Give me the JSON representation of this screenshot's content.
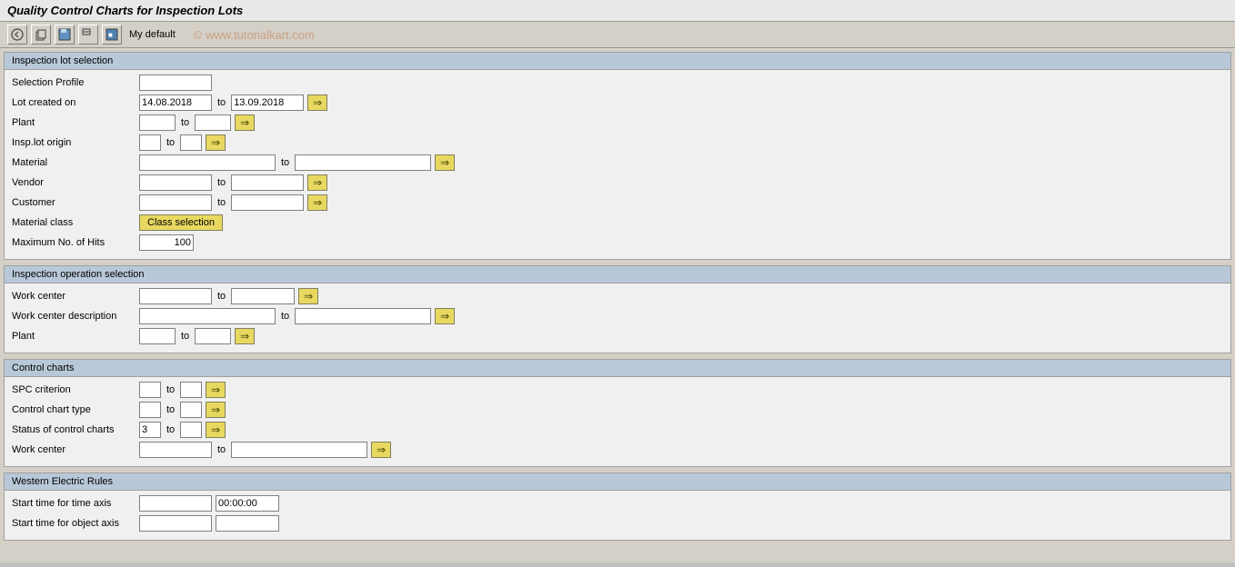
{
  "title": "Quality Control Charts for Inspection Lots",
  "toolbar": {
    "buttons": [
      "back",
      "forward",
      "save",
      "find",
      "settings"
    ],
    "default_label": "My default"
  },
  "watermark": "© www.tutorialkart.com",
  "sections": {
    "inspection_lot": {
      "header": "Inspection lot selection",
      "fields": {
        "selection_profile": {
          "label": "Selection Profile",
          "value": "",
          "type": "single"
        },
        "lot_created_on": {
          "label": "Lot created on",
          "from": "14.08.2018",
          "to": "13.09.2018",
          "has_arrow": true
        },
        "plant": {
          "label": "Plant",
          "from": "",
          "to": "",
          "has_arrow": true,
          "size": "small"
        },
        "insp_lot_origin": {
          "label": "Insp.lot origin",
          "from": "",
          "to": "",
          "has_arrow": true,
          "size": "tiny"
        },
        "material": {
          "label": "Material",
          "from": "",
          "to": "",
          "has_arrow": true,
          "size": "large"
        },
        "vendor": {
          "label": "Vendor",
          "from": "",
          "to": "",
          "has_arrow": true,
          "size": "medium"
        },
        "customer": {
          "label": "Customer",
          "from": "",
          "to": "",
          "has_arrow": true,
          "size": "medium"
        },
        "material_class": {
          "label": "Material class",
          "button": "Class selection"
        },
        "max_hits": {
          "label": "Maximum No. of Hits",
          "value": "100"
        }
      }
    },
    "inspection_operation": {
      "header": "Inspection operation selection",
      "fields": {
        "work_center": {
          "label": "Work center",
          "from": "",
          "to": "",
          "has_arrow": true
        },
        "work_center_desc": {
          "label": "Work center description",
          "from": "",
          "to": "",
          "has_arrow": true
        },
        "plant": {
          "label": "Plant",
          "from": "",
          "to": "",
          "has_arrow": true,
          "size": "small"
        }
      }
    },
    "control_charts": {
      "header": "Control charts",
      "fields": {
        "spc_criterion": {
          "label": "SPC criterion",
          "from": "",
          "to": "",
          "has_arrow": true,
          "size": "tiny"
        },
        "control_chart_type": {
          "label": "Control chart type",
          "from": "",
          "to": "",
          "has_arrow": true,
          "size": "tiny"
        },
        "status_control_charts": {
          "label": "Status of control charts",
          "from": "3",
          "to": "",
          "has_arrow": true,
          "size": "tiny"
        },
        "work_center": {
          "label": "Work center",
          "from": "",
          "to": "",
          "has_arrow": true
        }
      }
    },
    "western_electric": {
      "header": "Western Electric Rules",
      "fields": {
        "start_time_axis": {
          "label": "Start time for time axis",
          "value": "",
          "time": "00:00:00"
        },
        "start_object_axis": {
          "label": "Start time for object axis",
          "value": "",
          "time": ""
        }
      }
    }
  }
}
